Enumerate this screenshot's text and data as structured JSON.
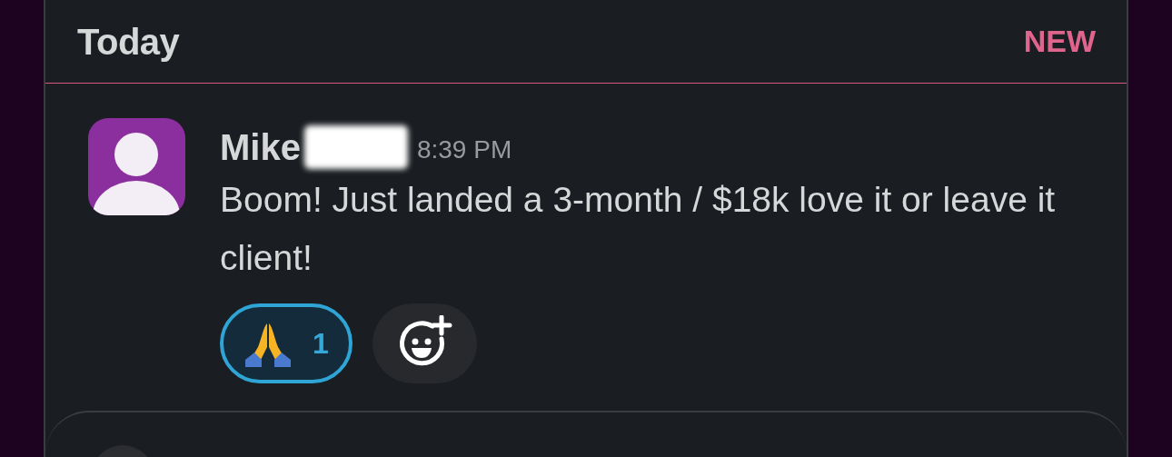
{
  "header": {
    "title": "Today",
    "badge": "NEW"
  },
  "message": {
    "author": "Mike",
    "time": "8:39 PM",
    "text": "Boom! Just landed a 3-month / $18k love it or leave it client!"
  },
  "reactions": [
    {
      "count": "1",
      "selected": true
    }
  ]
}
